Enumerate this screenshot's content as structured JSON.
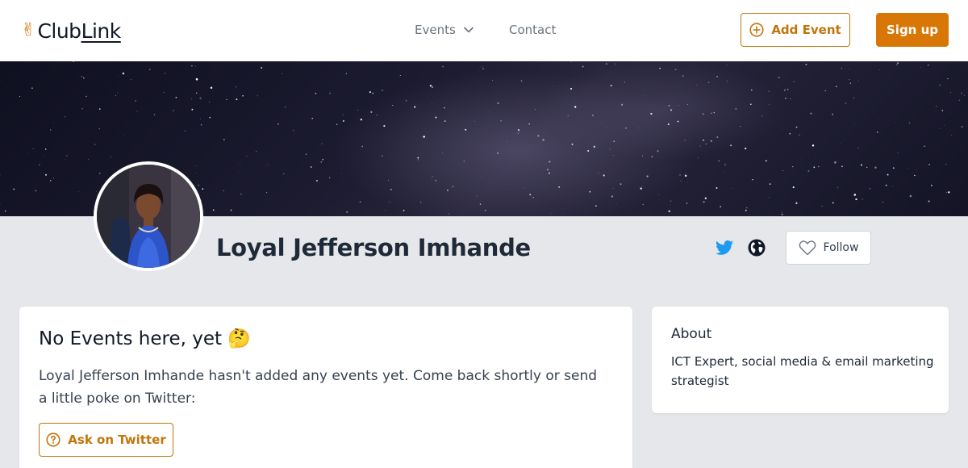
{
  "header": {
    "logo_prefix": "Club",
    "logo_suffix": "Link",
    "nav": {
      "events_label": "Events",
      "contact_label": "Contact"
    },
    "add_event_label": "Add Event",
    "signup_label": "Sign up"
  },
  "profile": {
    "name": "Loyal Jefferson Imhande",
    "follow_label": "Follow"
  },
  "events_card": {
    "title": "No Events here, yet 🤔",
    "message": "Loyal Jefferson Imhande hasn't added any events yet. Come back shortly or send a little poke on Twitter:",
    "ask_label": "Ask on Twitter"
  },
  "about_card": {
    "title": "About",
    "text": "ICT Expert, social media & email marketing strategist"
  },
  "colors": {
    "accent": "#d97706",
    "accent_border": "#c2750b",
    "twitter": "#1d9bf0",
    "page_bg": "#e5e7eb"
  },
  "icons": [
    "victory-hand-icon",
    "chevron-down-icon",
    "plus-circle-icon",
    "twitter-icon",
    "globe-icon",
    "heart-icon",
    "question-circle-icon"
  ]
}
